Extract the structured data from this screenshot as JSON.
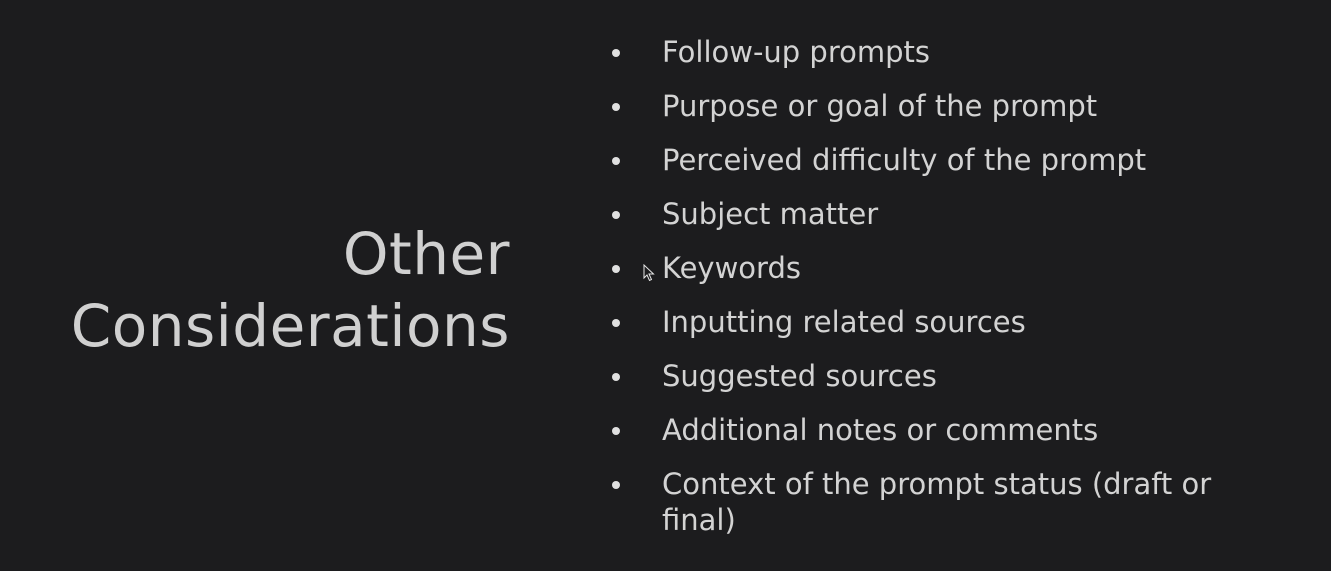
{
  "slide": {
    "title_line1": "Other",
    "title_line2": "Considerations",
    "bullets": [
      "Follow-up prompts",
      "Purpose or goal of the prompt",
      "Perceived difficulty of the prompt",
      "Subject matter",
      "Keywords",
      "Inputting related sources",
      "Suggested sources",
      "Additional notes or comments",
      "Context of the prompt status (draft or final)"
    ]
  },
  "colors": {
    "background": "#1c1c1e",
    "text": "#d3d3d3"
  },
  "icons": {
    "cursor": "mouse-pointer-icon",
    "bullet": "bullet-dot-icon"
  }
}
